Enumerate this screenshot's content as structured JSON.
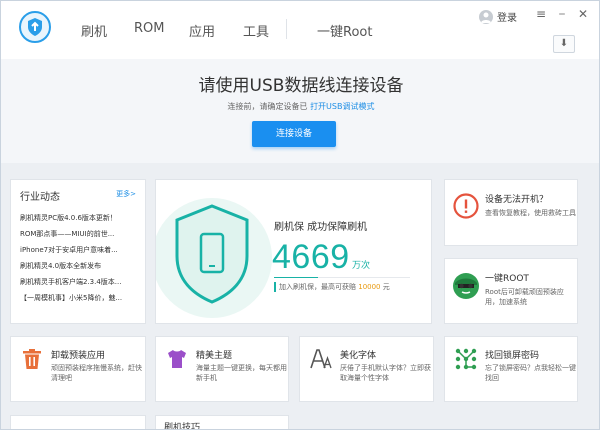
{
  "nav": {
    "items": [
      "刷机",
      "ROM",
      "应用",
      "工具",
      "一键Root"
    ],
    "login": "登录",
    "menu_icon": "hamburger-icon",
    "close_icon": "close-icon",
    "download_icon": "download-icon"
  },
  "connect": {
    "title": "请使用USB数据线连接设备",
    "sub_prefix": "连接前，请确定设备已",
    "sub_link": "打开USB调试模式",
    "button": "连接设备"
  },
  "news": {
    "title": "行业动态",
    "more": "更多>",
    "items": [
      "刷机精灵PC版4.0.6版本更新！",
      "ROM那点事——MIUI的前世...",
      "iPhone7对于安卓用户意味着...",
      "刷机精灵4.0版本全新发布",
      "刷机精灵手机客户端2.3.4版本...",
      "【一周模机事】小米5降价，魅..."
    ]
  },
  "hero": {
    "title": "刷机保  成功保障刷机",
    "count": "4669",
    "unit": "万次",
    "note_prefix": "加入刷机保，最高可获赔",
    "note_amount": "10000",
    "note_suffix": "元",
    "progress": 0.32
  },
  "right_cards": [
    {
      "title": "设备无法开机？",
      "desc": "查看恢复教程，使用救砖工具"
    },
    {
      "title": "一键ROOT",
      "desc": "Root后可卸载顽固预装应用，加速系统"
    }
  ],
  "bottom_cards": [
    {
      "title": "卸载预装应用",
      "desc": "顽固预装程序拖慢系统，赶快清理吧"
    },
    {
      "title": "精美主题",
      "desc": "海量主题一键更换，每天都用新手机"
    },
    {
      "title": "美化字体",
      "desc": "厌倦了手机默认字体？立即获取海量个性字体"
    },
    {
      "title": "找回锁屏密码",
      "desc": "忘了锁屏密码？点我轻松一键找回"
    }
  ],
  "partial_card": {
    "title": "刷机技巧"
  },
  "colors": {
    "accent": "#1a8ff0",
    "teal": "#18b2a6",
    "warning": "#e5533d",
    "gold": "#e89a10"
  }
}
